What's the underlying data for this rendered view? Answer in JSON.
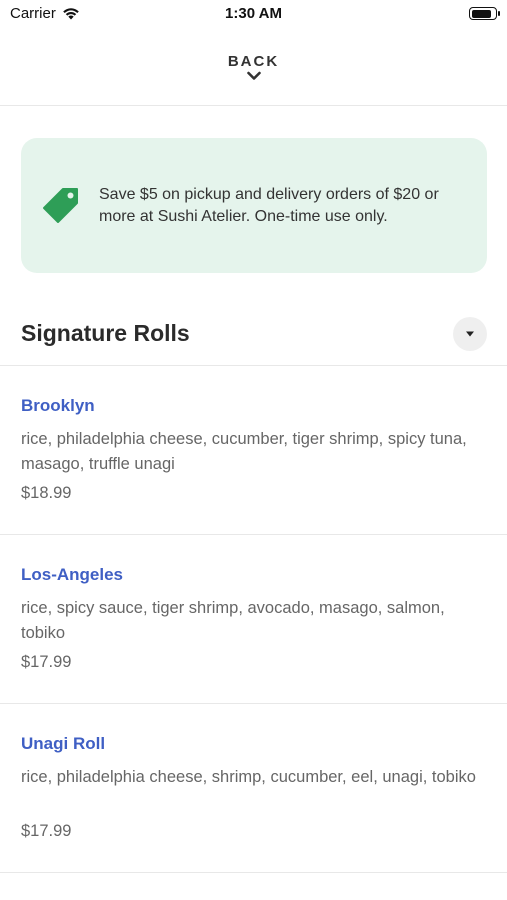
{
  "status_bar": {
    "carrier": "Carrier",
    "time": "1:30 AM",
    "battery_level": 0.9
  },
  "nav": {
    "back_label": "BACK"
  },
  "promo": {
    "text": "Save $5 on pickup and delivery orders of $20 or more at Sushi Atelier. One-time use only.",
    "icon": "price-tag-icon",
    "icon_color": "#2e9e57",
    "background": "#e5f4ec"
  },
  "section": {
    "title": "Signature Rolls",
    "toggle_icon": "caret-down-icon"
  },
  "items": [
    {
      "name": "Brooklyn",
      "description": "rice, philadelphia cheese, cucumber, tiger shrimp, spicy tuna, masago, truffle unagi",
      "price": "$18.99"
    },
    {
      "name": "Los-Angeles",
      "description": "rice, spicy sauce, tiger shrimp, avocado, masago, salmon, tobiko",
      "price": "$17.99"
    },
    {
      "name": "Unagi Roll",
      "description": "rice, philadelphia cheese, shrimp, cucumber, eel, unagi, tobiko",
      "price": "$17.99"
    }
  ],
  "colors": {
    "item_name": "#3f5fc4",
    "text_muted": "#666666"
  }
}
